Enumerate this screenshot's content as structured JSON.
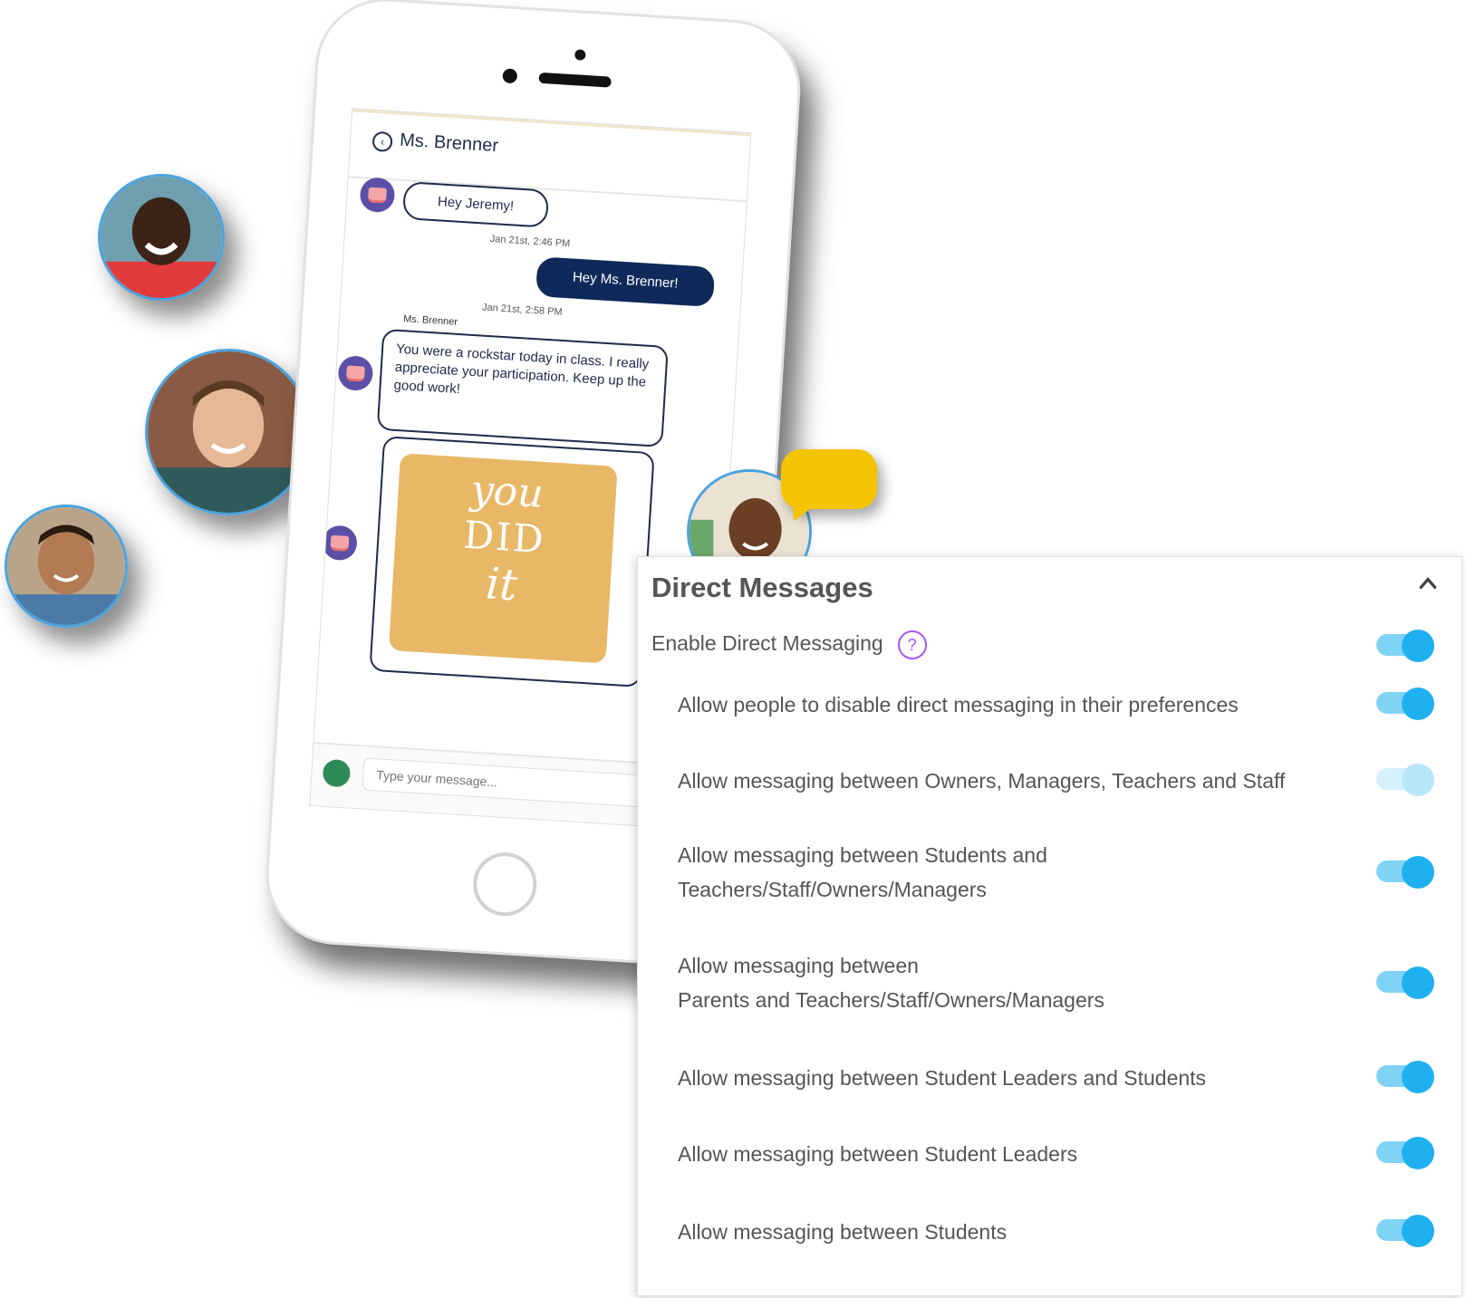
{
  "phone": {
    "chat_title": "Ms. Brenner",
    "messages": {
      "m1": "Hey Jeremy!",
      "m1_time": "Jan 21st, 2:46 PM",
      "m2": "Hey Ms. Brenner!",
      "m2_time": "Jan 21st, 2:58 PM",
      "m3_sender": "Ms. Brenner",
      "m3": "You were a rockstar today in class. I really appreciate your participation. Keep up the good work!",
      "card_line1": "you",
      "card_line2": "DID",
      "card_line3": "it"
    },
    "input_placeholder": "Type your message..."
  },
  "panel": {
    "title": "Direct Messages",
    "enable_label": "Enable Direct Messaging",
    "help_glyph": "?",
    "settings": [
      {
        "label": "Allow people to disable direct messaging in their preferences",
        "on": true
      },
      {
        "label": "Allow messaging between Owners, Managers, Teachers and Staff",
        "on": true,
        "disabled": true
      },
      {
        "label_line1": "Allow messaging between Students and",
        "label_line2": "Teachers/Staff/Owners/Managers",
        "on": true
      },
      {
        "label_line1": "Allow messaging between",
        "label_line2": "Parents and Teachers/Staff/Owners/Managers",
        "on": true
      },
      {
        "label": "Allow messaging between Student Leaders and Students",
        "on": true
      },
      {
        "label": "Allow messaging between Student Leaders",
        "on": true
      },
      {
        "label": "Allow messaging between Students",
        "on": true
      }
    ]
  },
  "colors": {
    "toggle_on": "#1fb0f0",
    "toggle_track": "#7fd3f5",
    "help_icon": "#a855f7",
    "outgoing_bubble": "#0f2a5a",
    "speech_bubble": "#f5c400",
    "card": "#e8b867"
  },
  "icons": [
    "back-arrow-icon",
    "question-mark-icon",
    "chevron-up-icon",
    "book-icon"
  ]
}
